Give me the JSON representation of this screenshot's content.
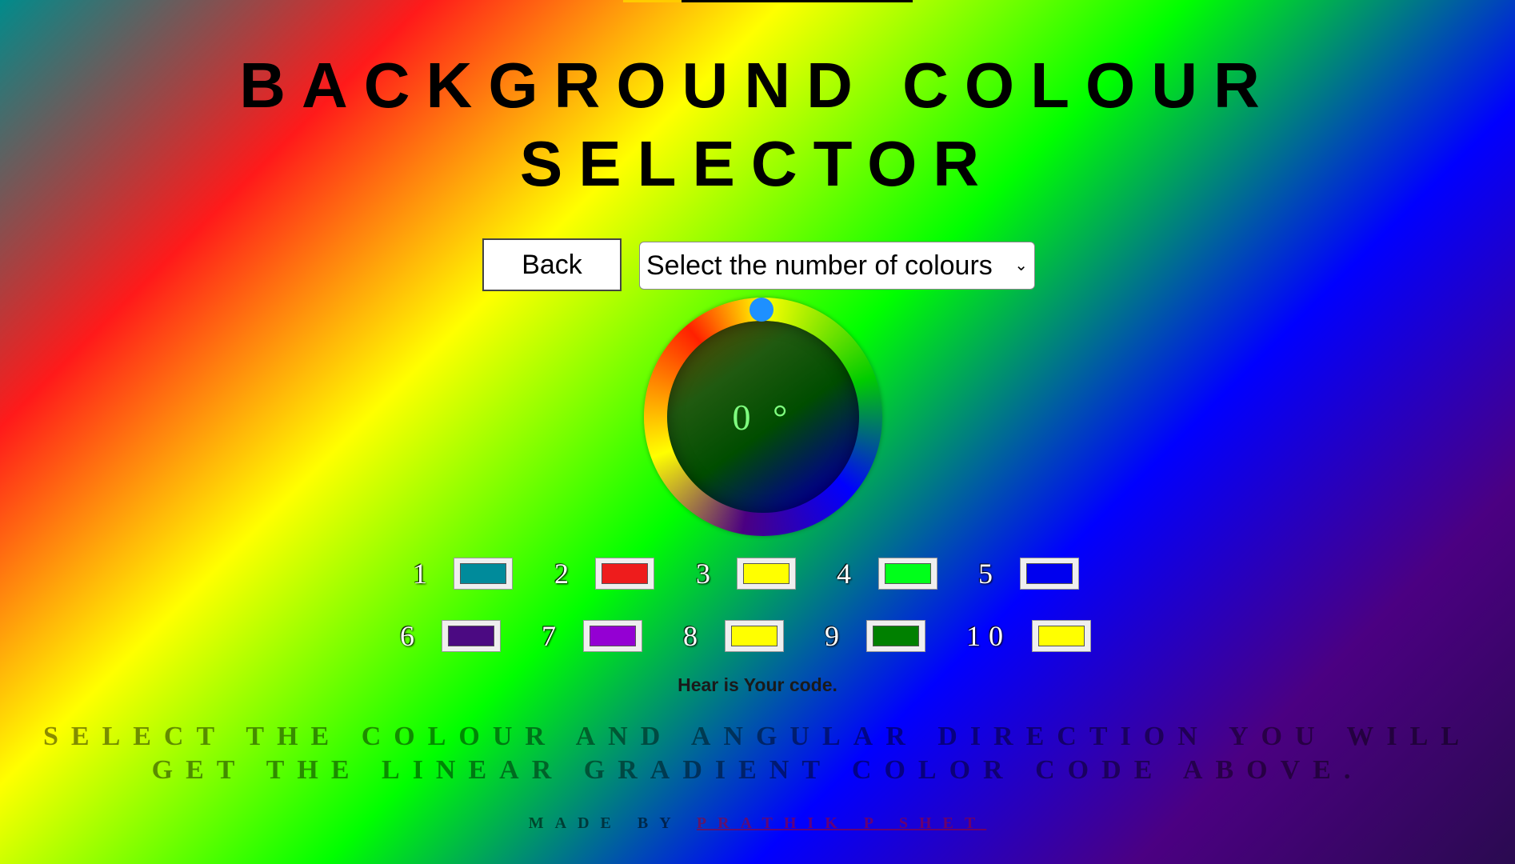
{
  "title": "BACKGROUND COLOUR SELECTOR",
  "controls": {
    "back_label": "Back",
    "select_value": "Select the number of colours"
  },
  "dial": {
    "angle_text": "0 °",
    "angle_value": 0
  },
  "swatches": [
    {
      "number": "1",
      "color": "#008b9b"
    },
    {
      "number": "2",
      "color": "#ee1c1c"
    },
    {
      "number": "3",
      "color": "#ffff00"
    },
    {
      "number": "4",
      "color": "#00ff1a"
    },
    {
      "number": "5",
      "color": "#0000ee"
    },
    {
      "number": "6",
      "color": "#4b0a82"
    },
    {
      "number": "7",
      "color": "#9400d3"
    },
    {
      "number": "8",
      "color": "#ffff00"
    },
    {
      "number": "9",
      "color": "#008000"
    },
    {
      "number": "10",
      "color": "#ffff00"
    }
  ],
  "code_label": "Hear is Your code.",
  "instructions": "SELECT THE COLOUR AND ANGULAR DIRECTION YOU WILL GET THE LINEAR GRADIENT COLOR CODE ABOVE.",
  "footer": {
    "made_by": "MADE BY",
    "author": "PRATHIK P SHET"
  }
}
